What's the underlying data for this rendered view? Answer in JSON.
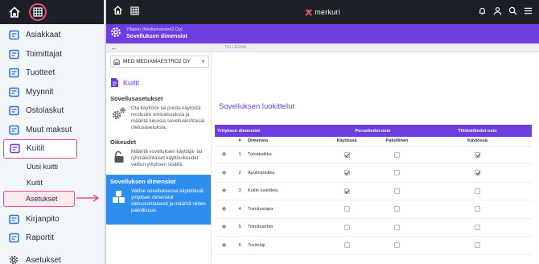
{
  "leftnav": {
    "items": [
      {
        "label": "Asiakkaat",
        "icon": "customers-icon",
        "color": "#2b6fd6"
      },
      {
        "label": "Toimittajat",
        "icon": "truck-icon",
        "color": "#2b6fd6"
      },
      {
        "label": "Tuotteet",
        "icon": "tag-icon",
        "color": "#2b6fd6"
      },
      {
        "label": "Myynnit",
        "icon": "sales-icon",
        "color": "#2b6fd6"
      },
      {
        "label": "Ostolaskut",
        "icon": "purchase-icon",
        "color": "#2b6fd6"
      },
      {
        "label": "Muut maksut",
        "icon": "payments-icon",
        "color": "#2b6fd6"
      },
      {
        "label": "Kuitit",
        "icon": "receipt-icon",
        "color": "#6d3de0"
      }
    ],
    "sub_items": [
      "Uusi kuitti",
      "Kuitit",
      "Asetukset"
    ],
    "items_after": [
      {
        "label": "Kirjanpito",
        "icon": "ledger-icon",
        "color": "#2b6fd6"
      },
      {
        "label": "Raportit",
        "icon": "reports-icon",
        "color": "#2b6fd6"
      }
    ],
    "bottom": {
      "label": "Asetukset",
      "icon": "gear-icon"
    }
  },
  "topbar": {
    "brand": "merkuri"
  },
  "titlebar": {
    "subtitle": "Ylläpito (Mediamaestro2 Oy)",
    "title": "Sovelluksen dimensiot"
  },
  "toolbar": {
    "back": "←",
    "save": "TALLENNA"
  },
  "settings": {
    "company": "MED MEDIAMAESTRO2 OY",
    "module": "Kuitit",
    "sections": [
      {
        "title": "Sovellusasetukset",
        "text": "Ota käyttöön tai poista käytöstä moduulin ominaisuuksia ja määritä lukuisia sovelluskohtaisia oletusasetuksia."
      },
      {
        "title": "Oikeudet",
        "text": "Määritä sovelluksen käyttäjä- tai ryhmäkohtaiset käyttöoikeudet valitun yrityksen sisällä."
      }
    ],
    "active": {
      "title": "Sovelluksen dimensiot",
      "text": "Valitse sovelluksessa käytettävät yrityksen dimensiot oletuskohtaisesti ja määritä niiden pakollisuus."
    }
  },
  "main": {
    "heading": "Sovelluksen luokittelut",
    "table": {
      "group_headers": [
        "Yrityksen dimensiot",
        "Perustiedot-osio",
        "Tiliöintitiedot-osio"
      ],
      "sub_headers": [
        "#",
        "Dimensio",
        "Käytössä",
        "Pakollinen",
        "Käytössä"
      ],
      "rows": [
        {
          "n": "1",
          "name": "Tulospaikka",
          "used": true,
          "required": false,
          "acc_used": true
        },
        {
          "n": "2",
          "name": "Apulospaikka",
          "used": true,
          "required": false,
          "acc_used": true
        },
        {
          "n": "3",
          "name": "Kuitin luokittelu",
          "used": true,
          "required": false,
          "acc_used": false
        },
        {
          "n": "4",
          "name": "Toimitustapa",
          "used": false,
          "required": false,
          "acc_used": false
        },
        {
          "n": "5",
          "name": "Toimitusehto",
          "used": false,
          "required": false,
          "acc_used": false
        },
        {
          "n": "6",
          "name": "Tositelaji",
          "used": false,
          "required": false,
          "acc_used": false
        }
      ]
    }
  }
}
